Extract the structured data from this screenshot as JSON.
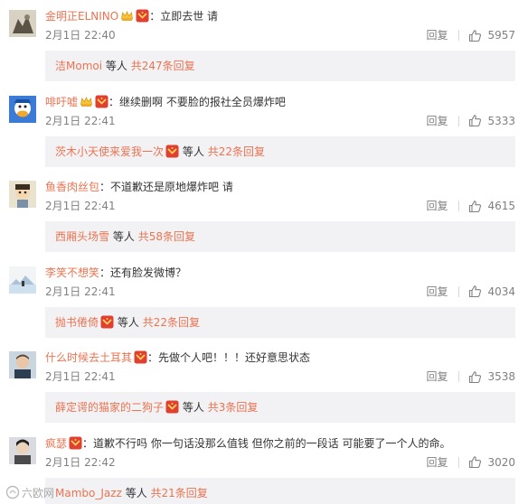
{
  "colors": {
    "accent": "#eb7350",
    "text": "#333333",
    "muted": "#808080",
    "subbox_bg": "#f2f2f5",
    "badge_red": "#e0402f",
    "badge_gold": "#f6c33a"
  },
  "ui": {
    "reply_label": "回复",
    "etc_label": "等人",
    "separator": "："
  },
  "watermark": {
    "text": "六欧网"
  },
  "comments": [
    {
      "username": "金明正ELNINO",
      "badges": [
        "vip-crown-icon",
        "member-badge-icon"
      ],
      "text": "立即去世 请",
      "time": "2月1日 22:40",
      "likes": "5957",
      "sub": {
        "user": "洁Momoi",
        "has_badge": false,
        "total": "共247条回复"
      }
    },
    {
      "username": "啡吁嘘",
      "badges": [
        "vip-crown-icon",
        "member-badge-icon"
      ],
      "text": "继续删啊 不要脸的报社全员爆炸吧",
      "time": "2月1日 22:41",
      "likes": "5333",
      "sub": {
        "user": "茨木小天使来爱我一次",
        "has_badge": true,
        "total": "共22条回复"
      }
    },
    {
      "username": "鱼香肉丝包",
      "badges": [],
      "text": "不道歉还是原地爆炸吧 请",
      "time": "2月1日 22:41",
      "likes": "4615",
      "sub": {
        "user": "西厢头场雪",
        "has_badge": false,
        "total": "共58条回复"
      }
    },
    {
      "username": "李笑不想笑",
      "badges": [],
      "text": "还有脸发微博？",
      "time": "2月1日 22:41",
      "likes": "4034",
      "sub": {
        "user": "抛书倦倚",
        "has_badge": true,
        "total": "共22条回复"
      }
    },
    {
      "username": "什么时候去土耳其",
      "badges": [
        "member-badge-icon"
      ],
      "text": "先做个人吧！！！还好意思状态",
      "time": "2月1日 22:41",
      "likes": "3538",
      "sub": {
        "user": "薛定谔的猫家的二狗子",
        "has_badge": true,
        "total": "共3条回复"
      }
    },
    {
      "username": "疯瑟",
      "badges": [
        "member-badge-icon"
      ],
      "text": "道歉不行吗 你一句话没那么值钱 但你之前的一段话 可能要了一个人的命。",
      "time": "2月1日 22:42",
      "likes": "3020",
      "sub": {
        "user": "Mambo_Jazz",
        "has_badge": false,
        "total": "共21条回复"
      }
    }
  ]
}
